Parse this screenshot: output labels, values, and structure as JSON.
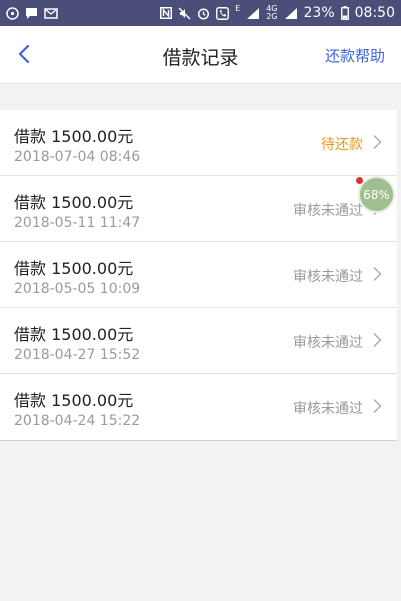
{
  "status_bar": {
    "battery": "23%",
    "time": "08:50",
    "network_top": "4G",
    "network_bottom": "2G",
    "lte_indicator": "E",
    "left_icons": [
      "compass-icon",
      "message-icon",
      "mail-icon"
    ],
    "right_icons": [
      "nfc-n-icon",
      "mute-icon",
      "alarm-icon",
      "phone-icon",
      "signal-icon",
      "battery-icon"
    ]
  },
  "header": {
    "title": "借款记录",
    "help_label": "还款帮助",
    "accent_color": "#3d64d8"
  },
  "records": [
    {
      "title": "借款 1500.00元",
      "date": "2018-07-04 08:46",
      "status": "待还款",
      "status_color": "#e8991c"
    },
    {
      "title": "借款 1500.00元",
      "date": "2018-05-11 11:47",
      "status": "审核未通过",
      "status_color": "#9a9aa0"
    },
    {
      "title": "借款 1500.00元",
      "date": "2018-05-05 10:09",
      "status": "审核未通过",
      "status_color": "#9a9aa0"
    },
    {
      "title": "借款 1500.00元",
      "date": "2018-04-27 15:52",
      "status": "审核未通过",
      "status_color": "#9a9aa0"
    },
    {
      "title": "借款 1500.00元",
      "date": "2018-04-24 15:22",
      "status": "审核未通过",
      "status_color": "#9a9aa0"
    }
  ],
  "floating_widget": {
    "percent": "68%"
  }
}
